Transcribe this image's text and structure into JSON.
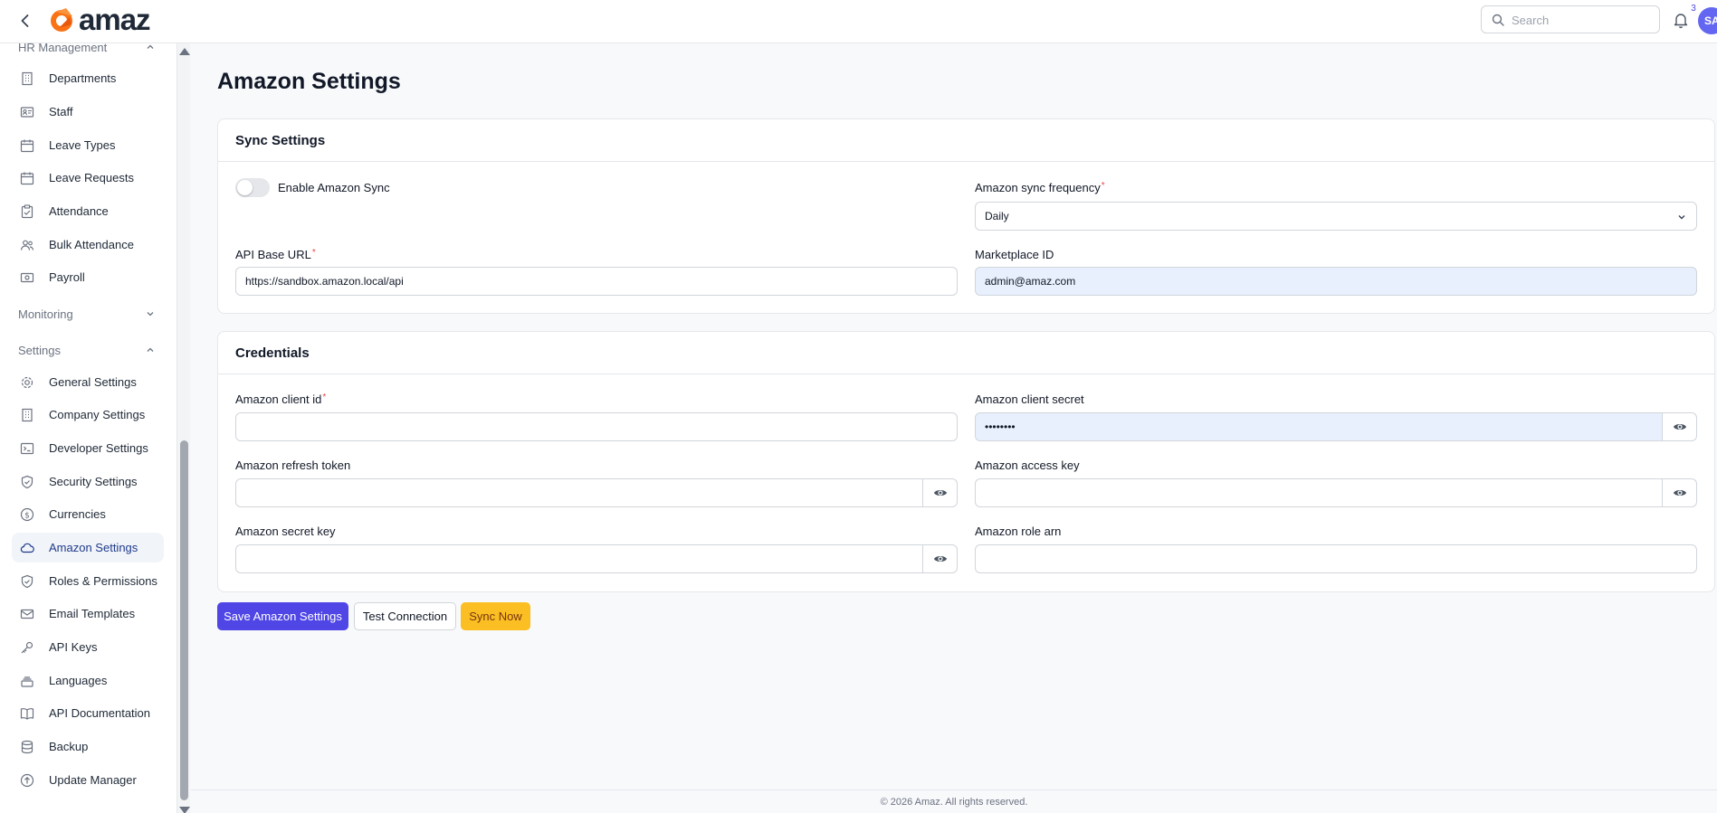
{
  "header": {
    "brand": "amaz",
    "search_placeholder": "Search",
    "notification_count": "3",
    "avatar_initials": "SA"
  },
  "sidebar": {
    "groups": {
      "hr": "HR Management",
      "monitoring": "Monitoring",
      "settings": "Settings"
    },
    "hr_items": [
      {
        "label": "Departments",
        "icon": "building-icon"
      },
      {
        "label": "Staff",
        "icon": "id-card-icon"
      },
      {
        "label": "Leave Types",
        "icon": "calendar-icon"
      },
      {
        "label": "Leave Requests",
        "icon": "calendar-icon"
      },
      {
        "label": "Attendance",
        "icon": "clipboard-check-icon"
      },
      {
        "label": "Bulk Attendance",
        "icon": "users-icon"
      },
      {
        "label": "Payroll",
        "icon": "banknote-icon"
      }
    ],
    "settings_items": [
      {
        "label": "General Settings",
        "icon": "gear-icon"
      },
      {
        "label": "Company Settings",
        "icon": "building-icon"
      },
      {
        "label": "Developer Settings",
        "icon": "terminal-icon"
      },
      {
        "label": "Security Settings",
        "icon": "shield-check-icon"
      },
      {
        "label": "Currencies",
        "icon": "dollar-circle-icon"
      },
      {
        "label": "Amazon Settings",
        "icon": "cloud-icon"
      },
      {
        "label": "Roles & Permissions",
        "icon": "shield-check-icon"
      },
      {
        "label": "Email Templates",
        "icon": "envelope-icon"
      },
      {
        "label": "API Keys",
        "icon": "key-icon"
      },
      {
        "label": "Languages",
        "icon": "stack-icon"
      },
      {
        "label": "API Documentation",
        "icon": "book-icon"
      },
      {
        "label": "Backup",
        "icon": "database-icon"
      },
      {
        "label": "Update Manager",
        "icon": "arrow-up-circle-icon"
      }
    ],
    "active_item": "Amazon Settings"
  },
  "page": {
    "title": "Amazon Settings"
  },
  "sync_settings": {
    "heading": "Sync Settings",
    "enable_label": "Enable Amazon Sync",
    "enable_on": false,
    "frequency_label": "Amazon sync frequency",
    "frequency_value": "Daily",
    "base_url_label": "API Base URL",
    "base_url_value": "https://sandbox.amazon.local/api",
    "marketplace_label": "Marketplace ID",
    "marketplace_value": "admin@amaz.com"
  },
  "credentials": {
    "heading": "Credentials",
    "client_id_label": "Amazon client id",
    "client_id_value": "",
    "client_secret_label": "Amazon client secret",
    "client_secret_value": "••••••••",
    "refresh_token_label": "Amazon refresh token",
    "refresh_token_value": "",
    "access_key_label": "Amazon access key",
    "access_key_value": "",
    "secret_key_label": "Amazon secret key",
    "secret_key_value": "",
    "role_arn_label": "Amazon role arn",
    "role_arn_value": ""
  },
  "actions": {
    "save": "Save Amazon Settings",
    "test": "Test Connection",
    "sync": "Sync Now"
  },
  "footer": {
    "text": "© 2026 Amaz. All rights reserved."
  },
  "colors": {
    "primary": "#4f46e5",
    "warning": "#fbbf24",
    "autofill": "#e8f0fe",
    "logo": "#f97316"
  }
}
